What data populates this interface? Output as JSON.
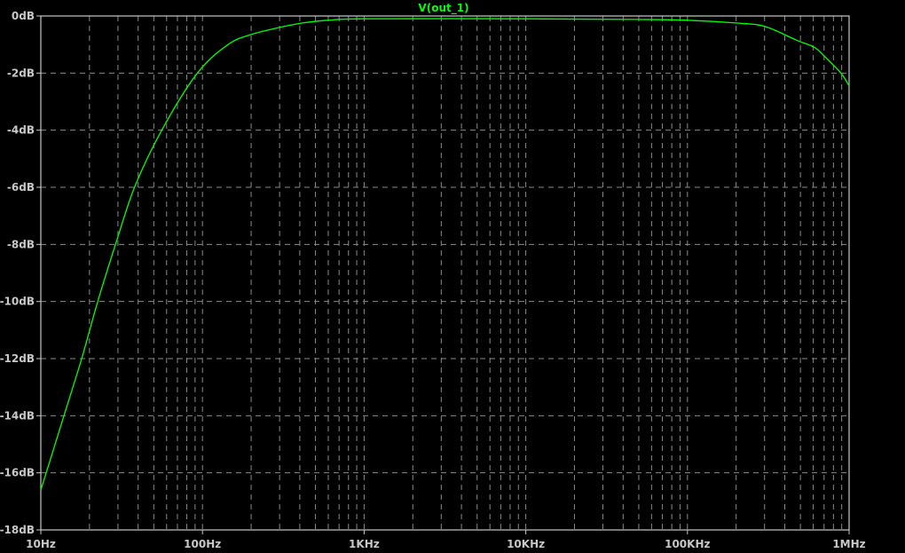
{
  "chart_data": {
    "type": "line",
    "title": "V(out_1)",
    "xscale": "log",
    "xlim": [
      10,
      1000000
    ],
    "ylim": [
      -18,
      0
    ],
    "grid": true,
    "x_tick_labels": [
      "10Hz",
      "100Hz",
      "1KHz",
      "10KHz",
      "100KHz",
      "1MHz"
    ],
    "x_tick_values": [
      10,
      100,
      1000,
      10000,
      100000,
      1000000
    ],
    "y_tick_labels": [
      "0dB",
      "-2dB",
      "-4dB",
      "-6dB",
      "-8dB",
      "-10dB",
      "-12dB",
      "-14dB",
      "-16dB",
      "-18dB"
    ],
    "y_tick_values": [
      0,
      -2,
      -4,
      -6,
      -8,
      -10,
      -12,
      -14,
      -16,
      -18
    ],
    "colors": {
      "background": "#000000",
      "trace": "#00ff00",
      "axis": "#c8c8c8",
      "grid": "#8a8a8a"
    },
    "series": [
      {
        "name": "V(out_1)",
        "x": [
          10,
          10.8,
          13.9,
          17.9,
          22.5,
          29,
          38,
          56,
          93,
          144,
          200,
          300,
          412,
          600,
          1000,
          10000,
          50000,
          100000,
          204000,
          302000,
          474000,
          611000,
          700000,
          890000,
          1000000
        ],
        "y": [
          -16.6,
          -16,
          -14,
          -12,
          -10,
          -8,
          -6,
          -4,
          -2,
          -1,
          -0.65,
          -0.4,
          -0.25,
          -0.15,
          -0.1,
          -0.1,
          -0.12,
          -0.15,
          -0.25,
          -0.37,
          -0.85,
          -1.1,
          -1.4,
          -2,
          -2.45
        ]
      }
    ]
  }
}
